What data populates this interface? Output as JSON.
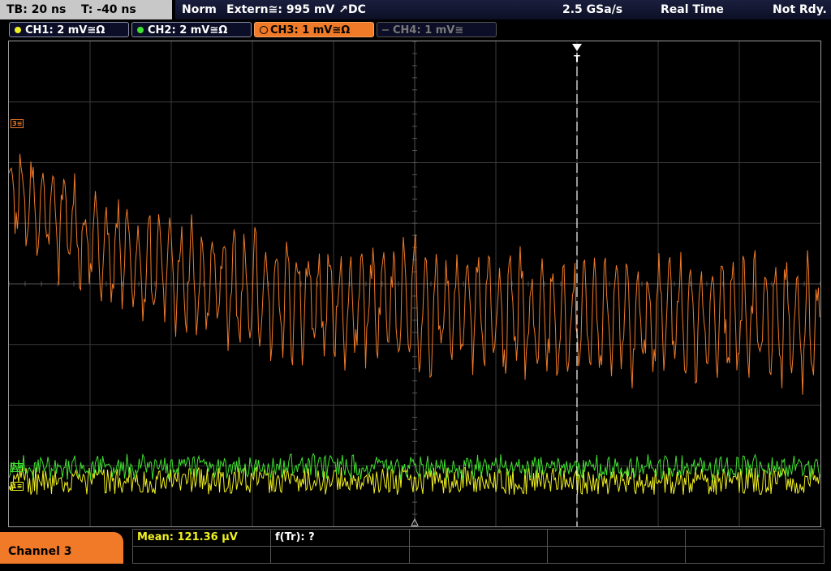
{
  "timebase": {
    "tb": "TB: 20 ns",
    "offset": "T: -40 ns"
  },
  "trigger_status": {
    "mode": "Norm",
    "source": "Extern≅: 995 mV ↗DC",
    "sample_rate": "2.5 GSa/s",
    "acq_mode": "Real Time",
    "state": "Not Rdy."
  },
  "channels": [
    {
      "label": "CH1: 2 mV≅Ω",
      "color": "#f0f020",
      "active": true
    },
    {
      "label": "CH2: 2 mV≅Ω",
      "color": "#40e030",
      "active": true
    },
    {
      "label": "CH3: 1 mV≅Ω",
      "color": "#f07a28",
      "active": true,
      "selected": true
    },
    {
      "label": "CH4: 1 mV≅",
      "color": "#7a7a7a",
      "active": false
    }
  ],
  "trigger_marker": "T",
  "waveform_tags": {
    "ch3": "3≡",
    "ch2": "2≡",
    "ch1": "1≡"
  },
  "bottom": {
    "channel_label": "Channel 3",
    "mean": "Mean: 121.36 μV",
    "freq": "f(Tr): ?"
  },
  "colors": {
    "ch1": "#f0f020",
    "ch2": "#40e030",
    "ch3": "#f07a28",
    "grid": "#3a3a3a",
    "selected_tab": "#f07a28"
  }
}
